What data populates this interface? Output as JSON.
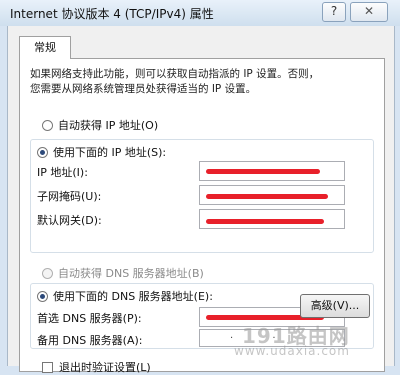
{
  "window": {
    "title": "Internet 协议版本 4 (TCP/IPv4) 属性",
    "help_glyph": "?",
    "close_glyph": "✕"
  },
  "tabs": [
    {
      "label": "常规"
    }
  ],
  "description": {
    "line1": "如果网络支持此功能，则可以获取自动指派的 IP 设置。否则，",
    "line2": "您需要从网络系统管理员处获得适当的 IP 设置。"
  },
  "ip_section": {
    "auto_label": "自动获得 IP 地址(O)",
    "manual_label": "使用下面的 IP 地址(S):",
    "fields": [
      {
        "label": "IP 地址(I):",
        "value": ""
      },
      {
        "label": "子网掩码(U):",
        "value": ""
      },
      {
        "label": "默认网关(D):",
        "value": ""
      }
    ]
  },
  "dns_section": {
    "auto_label": "自动获得 DNS 服务器地址(B)",
    "manual_label": "使用下面的 DNS 服务器地址(E):",
    "fields": [
      {
        "label": "首选 DNS 服务器(P):",
        "value": ""
      },
      {
        "label": "备用 DNS 服务器(A):",
        "value": ". ."
      }
    ]
  },
  "validate_checkbox_label": "退出时验证设置(L)",
  "advanced_button_label": "高级(V)...",
  "watermark": {
    "main": "191路由网",
    "url": "www.udaxia.com"
  },
  "colors": {
    "redaction": "#e8202a",
    "title_bar": "#d7e4f2"
  },
  "icons": {
    "help": "help-icon",
    "close": "close-icon"
  }
}
